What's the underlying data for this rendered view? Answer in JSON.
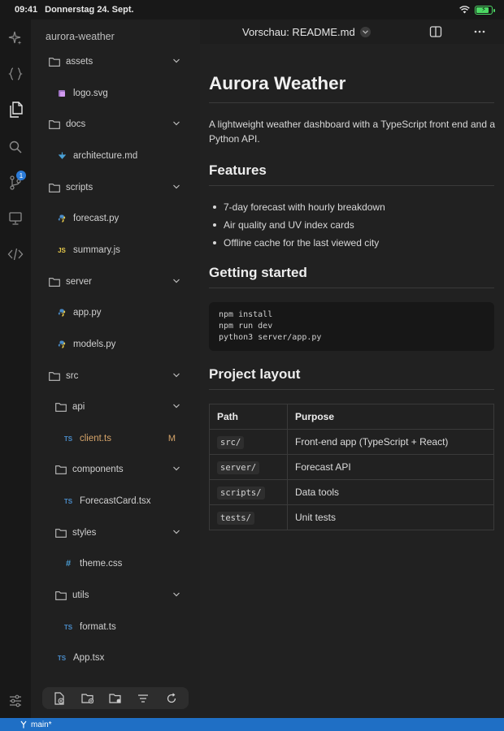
{
  "status": {
    "time": "09:41",
    "date": "Donnerstag 24. Sept.",
    "battery_percent": 90
  },
  "colors": {
    "accent": "#1f6fc5",
    "modified": "#d7a56a",
    "background": "#1e1e1e",
    "sidebar": "#202020"
  },
  "activity_bar": {
    "items": [
      {
        "icon": "sparkle-icon"
      },
      {
        "icon": "braces-icon"
      },
      {
        "icon": "files-icon",
        "active": true
      },
      {
        "icon": "search-icon"
      },
      {
        "icon": "source-control-icon",
        "badge": "1"
      },
      {
        "icon": "monitor-icon"
      },
      {
        "icon": "code-icon"
      },
      {
        "icon": "settings-sliders-icon"
      }
    ]
  },
  "explorer": {
    "project_name": "aurora-weather",
    "tree": [
      {
        "type": "folder",
        "label": "assets",
        "depth": 0
      },
      {
        "type": "file",
        "label": "logo.svg",
        "depth": 1,
        "icon": "svg-file-icon"
      },
      {
        "type": "folder",
        "label": "docs",
        "depth": 0
      },
      {
        "type": "file",
        "label": "architecture.md",
        "depth": 1,
        "icon": "markdown-file-icon"
      },
      {
        "type": "folder",
        "label": "scripts",
        "depth": 0
      },
      {
        "type": "file",
        "label": "forecast.py",
        "depth": 1,
        "icon": "python-file-icon"
      },
      {
        "type": "file",
        "label": "summary.js",
        "depth": 1,
        "icon": "js-file-icon",
        "glyph": "JS"
      },
      {
        "type": "folder",
        "label": "server",
        "depth": 0
      },
      {
        "type": "file",
        "label": "app.py",
        "depth": 1,
        "icon": "python-file-icon"
      },
      {
        "type": "file",
        "label": "models.py",
        "depth": 1,
        "icon": "python-file-icon"
      },
      {
        "type": "folder",
        "label": "src",
        "depth": 0
      },
      {
        "type": "folder",
        "label": "api",
        "depth": 1
      },
      {
        "type": "file",
        "label": "client.ts",
        "depth": 2,
        "icon": "ts-file-icon",
        "glyph": "TS",
        "status": "M"
      },
      {
        "type": "folder",
        "label": "components",
        "depth": 1
      },
      {
        "type": "file",
        "label": "ForecastCard.tsx",
        "depth": 2,
        "icon": "ts-file-icon",
        "glyph": "TS"
      },
      {
        "type": "folder",
        "label": "styles",
        "depth": 1
      },
      {
        "type": "file",
        "label": "theme.css",
        "depth": 2,
        "icon": "css-file-icon",
        "glyph": "#"
      },
      {
        "type": "folder",
        "label": "utils",
        "depth": 1
      },
      {
        "type": "file",
        "label": "format.ts",
        "depth": 2,
        "icon": "ts-file-icon",
        "glyph": "TS"
      },
      {
        "type": "file",
        "label": "App.tsx",
        "depth": 1,
        "icon": "ts-file-icon",
        "glyph": "TS"
      }
    ],
    "toolbar": [
      {
        "icon": "new-file-icon"
      },
      {
        "icon": "new-folder-icon"
      },
      {
        "icon": "folder-settings-icon"
      },
      {
        "icon": "collapse-lines-icon"
      },
      {
        "icon": "refresh-icon"
      }
    ]
  },
  "editor": {
    "title": "Vorschau: README.md"
  },
  "readme": {
    "h1": "Aurora Weather",
    "intro": "A lightweight weather dashboard with a TypeScript front end and a Python API.",
    "features_heading": "Features",
    "features": [
      "7-day forecast with hourly breakdown",
      "Air quality and UV index cards",
      "Offline cache for the last viewed city"
    ],
    "getting_started_heading": "Getting started",
    "code_lines": [
      "npm install",
      "npm run dev",
      "python3 server/app.py"
    ],
    "layout_heading": "Project layout",
    "table": {
      "headers": [
        "Path",
        "Purpose"
      ],
      "rows": [
        [
          "src/",
          "Front-end app (TypeScript + React)"
        ],
        [
          "server/",
          "Forecast API"
        ],
        [
          "scripts/",
          "Data tools"
        ],
        [
          "tests/",
          "Unit tests"
        ]
      ]
    }
  },
  "statusbar": {
    "branch": "main*"
  }
}
